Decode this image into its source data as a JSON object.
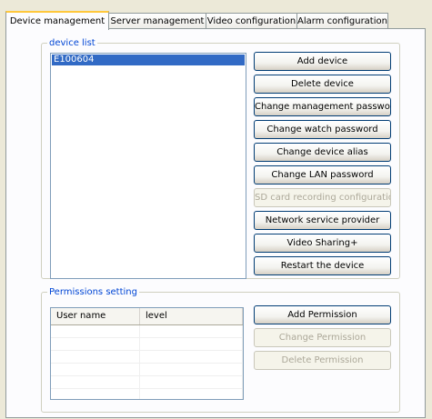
{
  "tabs": [
    {
      "label": "Device management",
      "active": true
    },
    {
      "label": "Server management",
      "active": false
    },
    {
      "label": "Video configuration",
      "active": false
    },
    {
      "label": "Alarm configuration",
      "active": false
    }
  ],
  "device_list": {
    "legend": "device list",
    "items": [
      "E100604"
    ],
    "selected_index": 0
  },
  "device_buttons": [
    {
      "label": "Add device",
      "enabled": true
    },
    {
      "label": "Delete device",
      "enabled": true
    },
    {
      "label": "Change management password",
      "enabled": true
    },
    {
      "label": "Change watch password",
      "enabled": true
    },
    {
      "label": "Change device alias",
      "enabled": true
    },
    {
      "label": "Change LAN password",
      "enabled": true
    },
    {
      "label": "SD card recording configuration",
      "enabled": false
    },
    {
      "label": "Network service provider",
      "enabled": true
    },
    {
      "label": "Video Sharing+",
      "enabled": true
    },
    {
      "label": "Restart the device",
      "enabled": true
    }
  ],
  "permissions": {
    "legend": "Permissions setting",
    "columns": [
      "User name",
      "level"
    ],
    "rows": [],
    "buttons": [
      {
        "label": "Add Permission",
        "enabled": true
      },
      {
        "label": "Change Permission",
        "enabled": false
      },
      {
        "label": "Delete Permission",
        "enabled": false
      }
    ]
  },
  "colors": {
    "window_bg": "#ece9d8",
    "panel_bg": "#fcfcfe",
    "legend_text": "#0046d5",
    "selection": "#316ac5",
    "active_tab_accent": "#ffc83c"
  }
}
